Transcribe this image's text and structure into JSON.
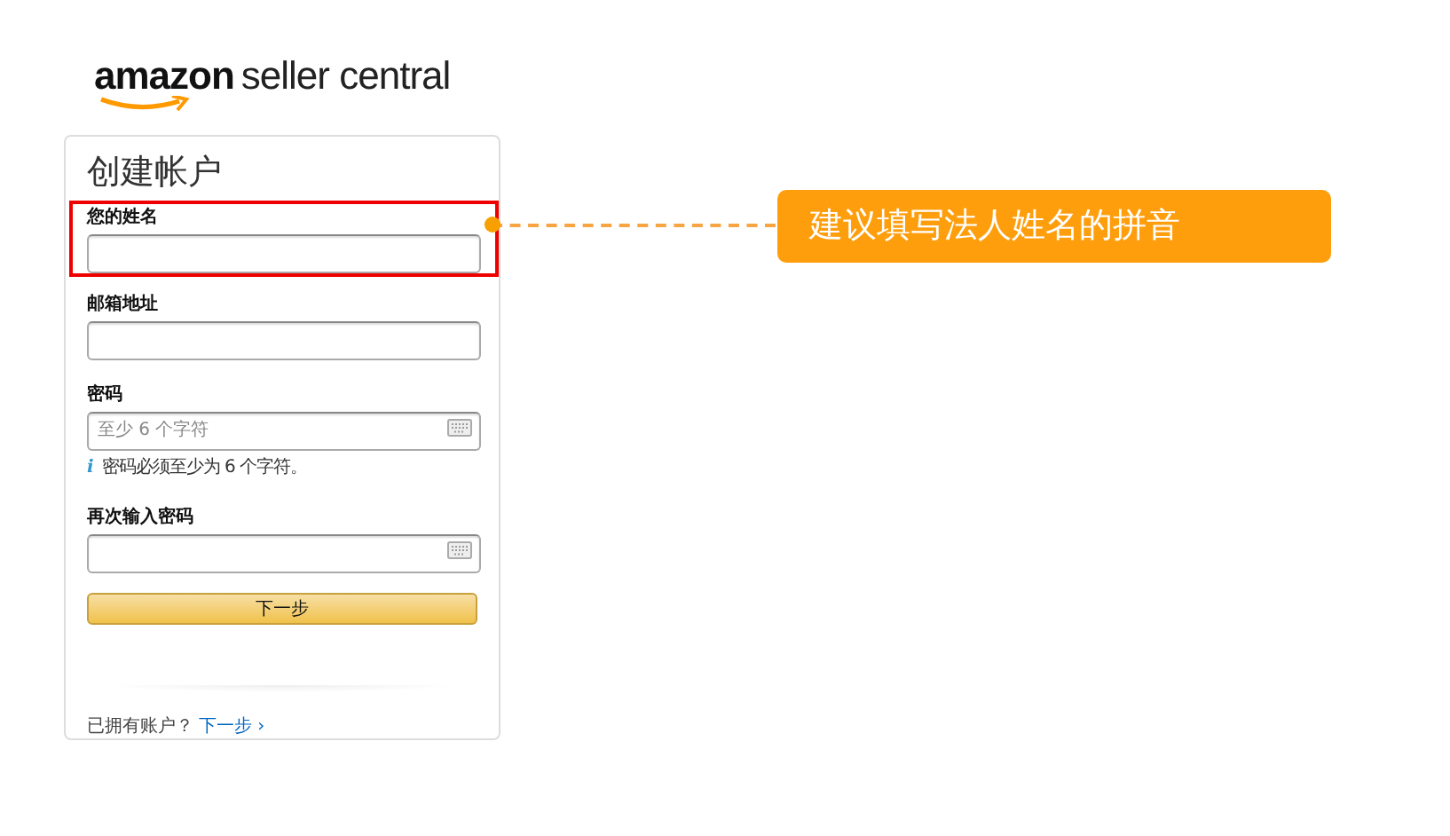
{
  "logo": {
    "brand": "amazon",
    "product": "seller central"
  },
  "form": {
    "title": "创建帐户",
    "fields": [
      {
        "label": "您的姓名",
        "kind": "text",
        "highlighted": true
      },
      {
        "label": "邮箱地址",
        "kind": "text",
        "highlighted": false
      },
      {
        "label": "密码",
        "kind": "password",
        "placeholder": "至少 6 个字符",
        "hint_icon": "i",
        "hint": "密码必须至少为 6 个字符。",
        "highlighted": false
      },
      {
        "label": "再次输入密码",
        "kind": "password",
        "highlighted": false
      }
    ],
    "submit": "下一步",
    "footer_text": "已拥有账户？",
    "footer_link": "下一步 ›"
  },
  "annotation": {
    "text": "建议填写法人姓名的拼音"
  }
}
